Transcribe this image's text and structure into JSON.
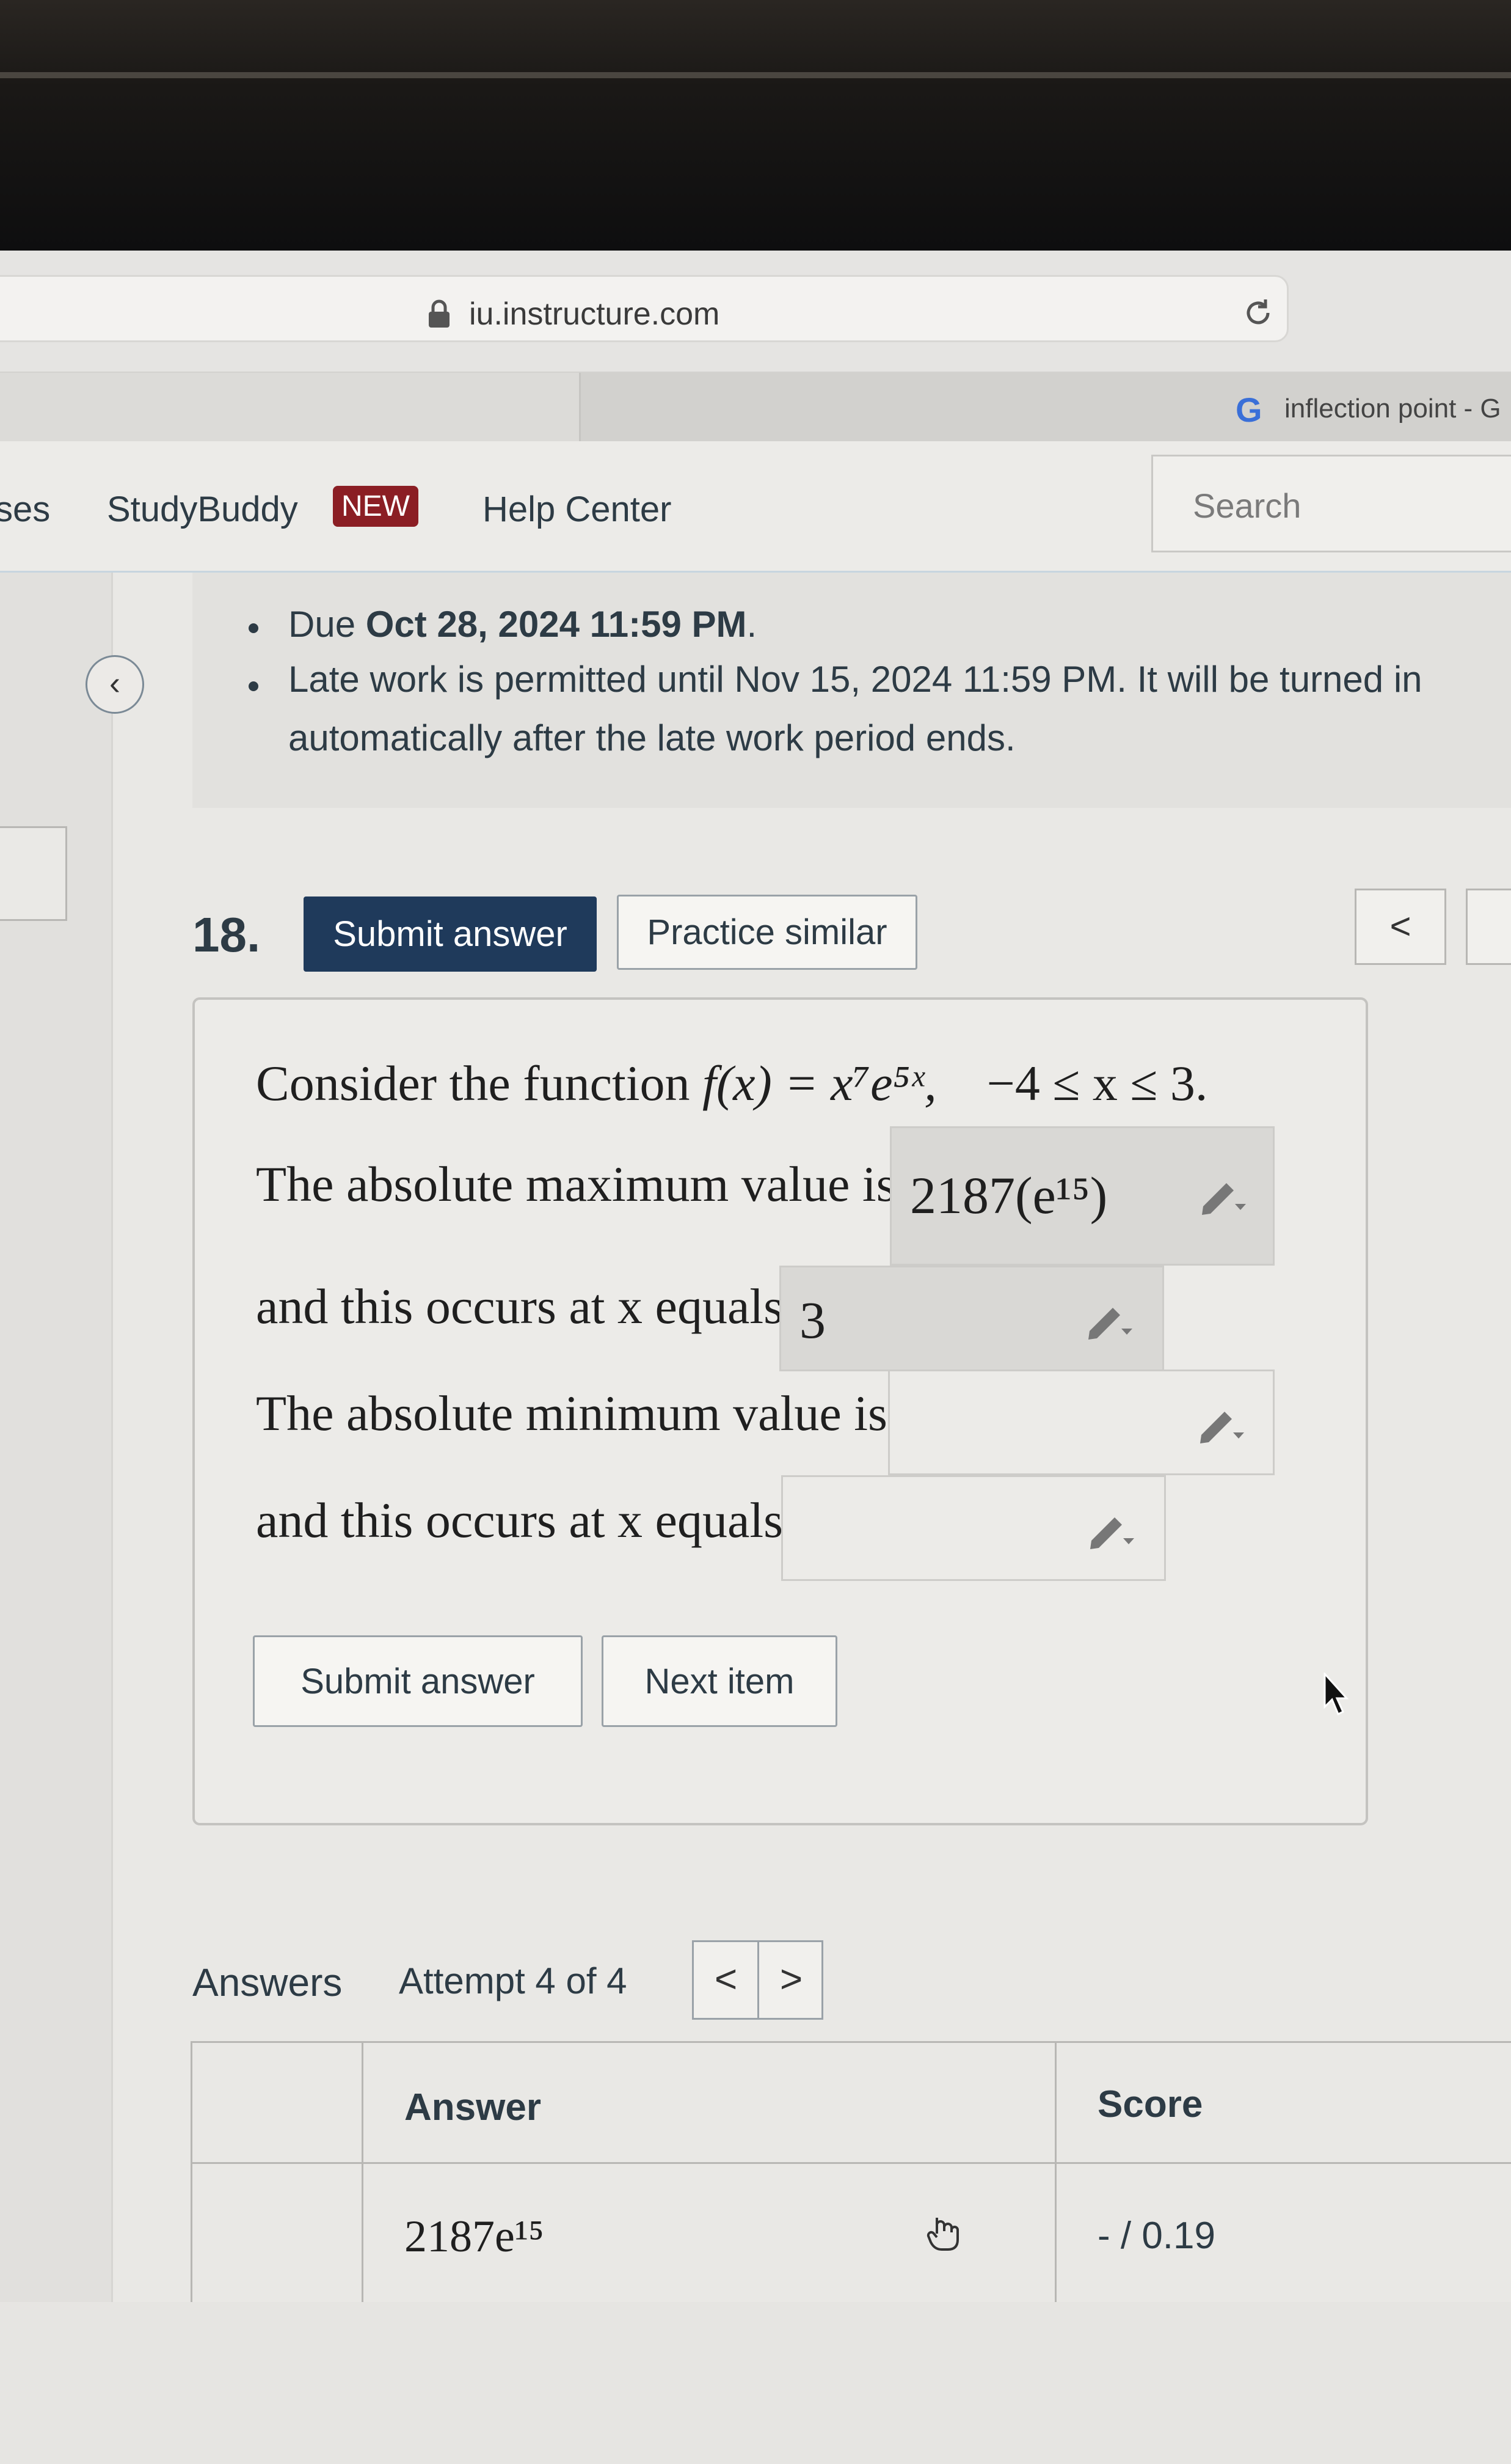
{
  "browser": {
    "url": "iu.instructure.com",
    "tab_title": "inflection point - G"
  },
  "navbar": {
    "items": [
      {
        "label": "ses"
      },
      {
        "label": "StudyBuddy"
      },
      {
        "label": "Help Center"
      }
    ],
    "new_badge": "NEW",
    "search_placeholder": "Search"
  },
  "assignment_info": {
    "due_prefix": "Due ",
    "due_date": "Oct 28, 2024 11:59 PM",
    "due_suffix": ".",
    "late_line1": "Late work is permitted until Nov 15, 2024 11:59 PM. It will be turned in",
    "late_line2": "automatically after the late work period ends."
  },
  "question": {
    "number": "18.",
    "submit_label": "Submit answer",
    "practice_label": "Practice similar",
    "prev_arrow": "<",
    "function_prefix": "Consider the function",
    "function_expr": "f(x) = x⁷e⁵ˣ,",
    "domain_expr": "−4 ≤ x ≤ 3.",
    "max_label": "The absolute maximum value is",
    "max_value": "2187(e¹⁵)",
    "max_at_label": "and this occurs at x equals",
    "max_at_value": "3",
    "min_label": "The absolute minimum value is",
    "min_value": "",
    "min_at_label": "and this occurs at x equals",
    "min_at_value": "",
    "bottom_submit_label": "Submit answer",
    "next_label": "Next item"
  },
  "answers": {
    "label": "Answers",
    "attempt": "Attempt 4 of 4",
    "prev": "<",
    "next": ">",
    "columns": [
      "",
      "Answer",
      "Score"
    ],
    "rows": [
      {
        "answer": "2187e¹⁵",
        "score": "- / 0.19"
      }
    ]
  }
}
